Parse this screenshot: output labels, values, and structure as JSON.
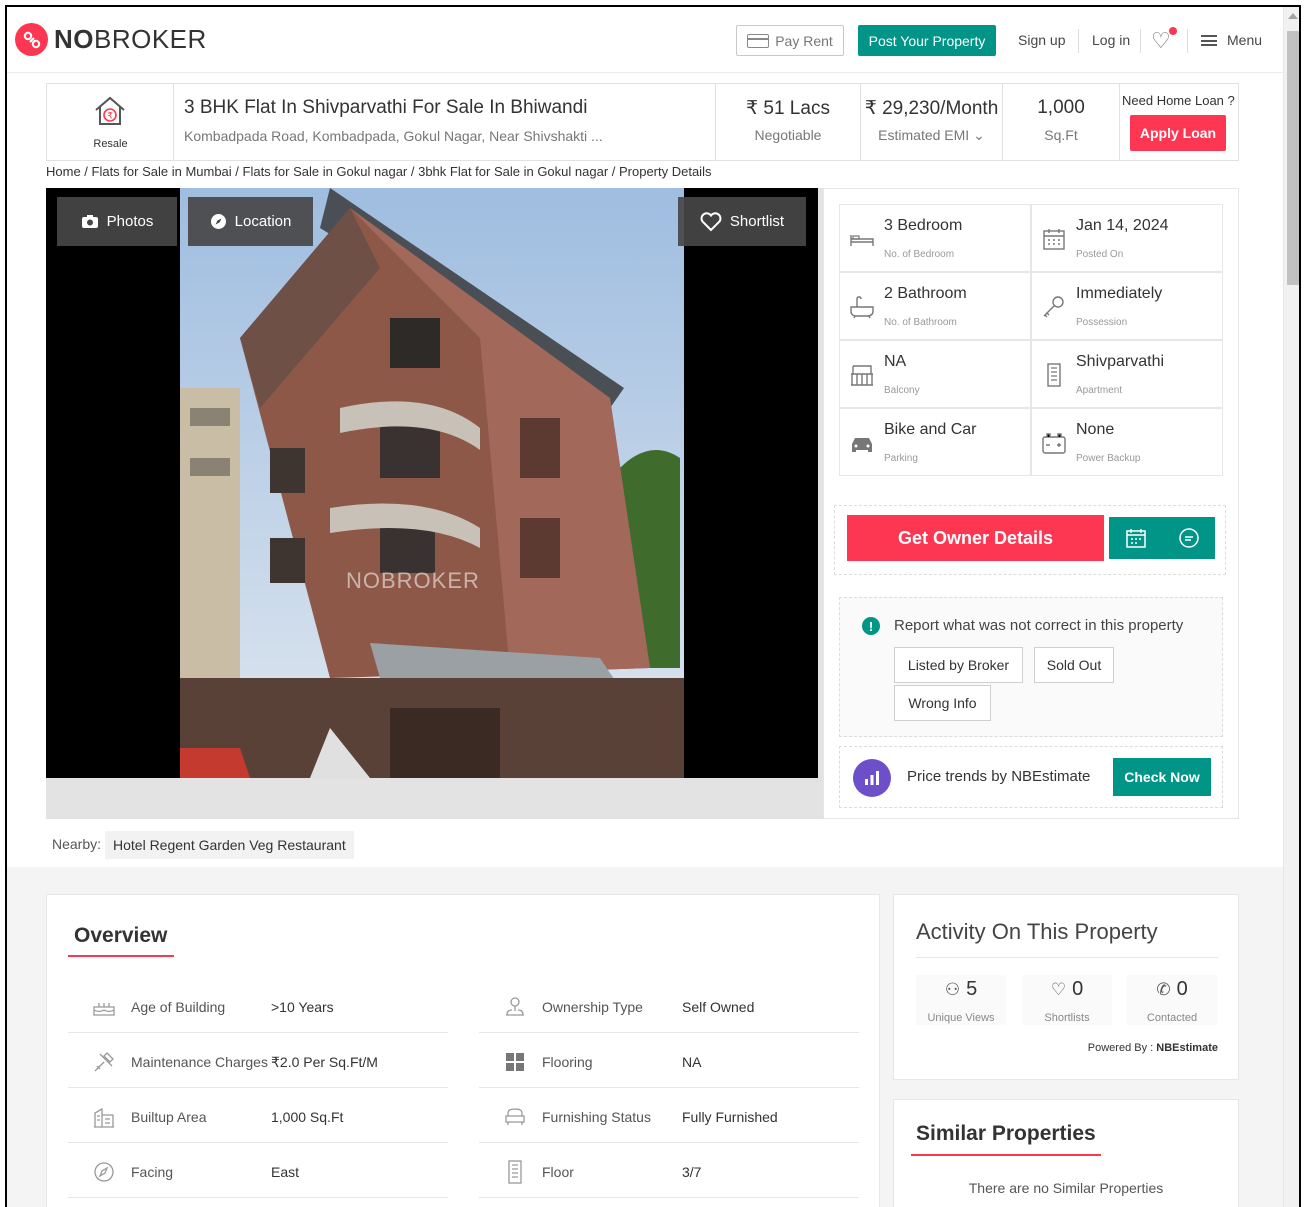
{
  "header": {
    "logo_prefix": "NO",
    "logo_suffix": "BROKER",
    "pay_rent": "Pay Rent",
    "post_property": "Post Your Property",
    "sign_up": "Sign up",
    "log_in": "Log in",
    "menu": "Menu"
  },
  "property": {
    "badge": "Resale",
    "title": "3 BHK Flat In Shivparvathi For Sale In Bhiwandi",
    "address": "Kombadpada Road, Kombadpada, Gokul Nagar, Near Shivshakti ...",
    "price": "₹ 51 Lacs",
    "price_note": "Negotiable",
    "emi": "₹ 29,230/Month",
    "emi_note": "Estimated EMI",
    "area": "1,000",
    "area_unit": "Sq.Ft",
    "loan_question": "Need Home Loan ?",
    "loan_button": "Apply Loan"
  },
  "breadcrumb": "Home / Flats for Sale in Mumbai / Flats for Sale in Gokul nagar / 3bhk Flat for Sale in Gokul nagar / Property Details",
  "gallery": {
    "photos": "Photos",
    "location": "Location",
    "shortlist": "Shortlist",
    "watermark": "NOBROKER"
  },
  "specs": [
    {
      "value": "3 Bedroom",
      "label": "No. of Bedroom",
      "icon": "bed-icon"
    },
    {
      "value": "Jan 14, 2024",
      "label": "Posted On",
      "icon": "calendar-icon"
    },
    {
      "value": "2 Bathroom",
      "label": "No. of Bathroom",
      "icon": "bathtub-icon"
    },
    {
      "value": "Immediately",
      "label": "Possession",
      "icon": "key-icon"
    },
    {
      "value": "NA",
      "label": "Balcony",
      "icon": "balcony-icon"
    },
    {
      "value": "Shivparvathi",
      "label": "Apartment",
      "icon": "building-icon"
    },
    {
      "value": "Bike and Car",
      "label": "Parking",
      "icon": "car-icon"
    },
    {
      "value": "None",
      "label": "Power Backup",
      "icon": "battery-icon"
    }
  ],
  "owner": {
    "button": "Get Owner Details"
  },
  "report": {
    "title": "Report what was not correct in this property",
    "options": [
      "Listed by Broker",
      "Sold Out",
      "Wrong Info"
    ]
  },
  "trends": {
    "text": "Price trends by NBEstimate",
    "button": "Check Now"
  },
  "nearby": {
    "label": "Nearby:",
    "places": [
      "Hotel Regent Garden Veg Restaurant"
    ]
  },
  "overview": {
    "title": "Overview",
    "left": [
      {
        "label": "Age of Building",
        "value": ">10 Years",
        "icon": "cake-icon"
      },
      {
        "label": "Maintenance Charges",
        "value": "₹2.0 Per Sq.Ft/M",
        "icon": "tools-icon"
      },
      {
        "label": "Builtup Area",
        "value": "1,000 Sq.Ft",
        "icon": "building-area-icon"
      },
      {
        "label": "Facing",
        "value": "East",
        "icon": "compass-icon"
      }
    ],
    "right": [
      {
        "label": "Ownership Type",
        "value": "Self Owned",
        "icon": "ownership-icon"
      },
      {
        "label": "Flooring",
        "value": "NA",
        "icon": "tiles-icon"
      },
      {
        "label": "Furnishing Status",
        "value": "Fully Furnished",
        "icon": "sofa-icon"
      },
      {
        "label": "Floor",
        "value": "3/7",
        "icon": "floor-icon"
      }
    ]
  },
  "activity": {
    "title": "Activity On This Property",
    "stats": [
      {
        "count": "5",
        "label": "Unique Views",
        "icon": "user-icon"
      },
      {
        "count": "0",
        "label": "Shortlists",
        "icon": "heart-icon"
      },
      {
        "count": "0",
        "label": "Contacted",
        "icon": "phone-icon"
      }
    ],
    "powered_label": "Powered By :",
    "powered_brand": "NBEstimate"
  },
  "similar": {
    "title": "Similar Properties",
    "empty": "There are no Similar Properties"
  }
}
